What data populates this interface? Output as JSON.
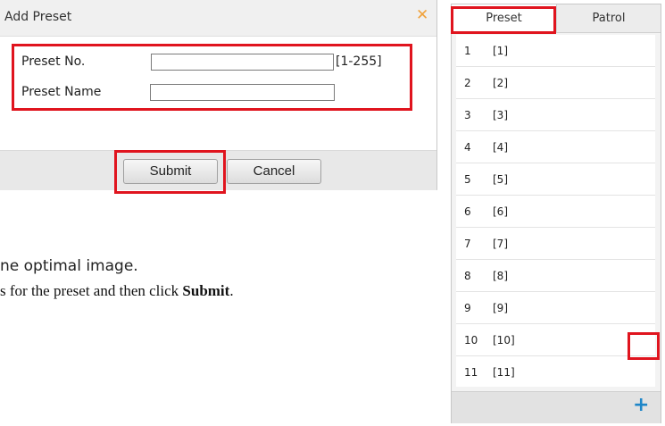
{
  "dialog": {
    "title": "Add Preset",
    "close_glyph": "✕",
    "preset_no_label": "Preset No.",
    "preset_no_value": "",
    "preset_no_range": "[1-255]",
    "preset_name_label": "Preset Name",
    "preset_name_value": "",
    "submit_label": "Submit",
    "cancel_label": "Cancel"
  },
  "background_text": {
    "line1": "ne optimal image.",
    "line2_prefix": "s for the preset and then click ",
    "line2_bold": "Submit",
    "line2_suffix": "."
  },
  "panel": {
    "tabs": [
      {
        "label": "Preset",
        "active": true
      },
      {
        "label": "Patrol",
        "active": false
      }
    ],
    "items": [
      {
        "num": "1",
        "name": "[1]"
      },
      {
        "num": "2",
        "name": "[2]"
      },
      {
        "num": "3",
        "name": "[3]"
      },
      {
        "num": "4",
        "name": "[4]"
      },
      {
        "num": "5",
        "name": "[5]"
      },
      {
        "num": "6",
        "name": "[6]"
      },
      {
        "num": "7",
        "name": "[7]"
      },
      {
        "num": "8",
        "name": "[8]"
      },
      {
        "num": "9",
        "name": "[9]"
      },
      {
        "num": "10",
        "name": "[10]"
      },
      {
        "num": "11",
        "name": "[11]"
      }
    ],
    "add_glyph": "+"
  },
  "colors": {
    "callout": "#e0141e",
    "close_icon": "#f0a23c",
    "add_icon": "#1e86c8"
  }
}
